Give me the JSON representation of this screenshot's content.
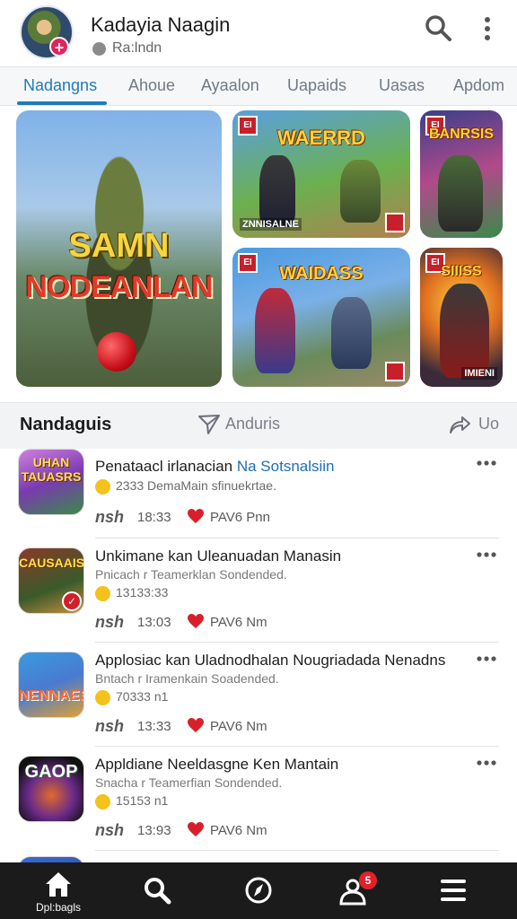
{
  "header": {
    "profile_name": "Kadayia Naagin",
    "profile_sub": "Ra:lndn"
  },
  "tabs": [
    {
      "label": "Nadangns",
      "active": true
    },
    {
      "label": "Ahoue",
      "active": false
    },
    {
      "label": "Ayaalon",
      "active": false
    },
    {
      "label": "Uapaids",
      "active": false
    },
    {
      "label": "Uasas",
      "active": false
    },
    {
      "label": "Apdom",
      "active": false
    }
  ],
  "featured": {
    "big": {
      "title_line1": "SAMN",
      "title_line2": "NODEANLAN"
    },
    "cards": [
      {
        "badge": "EI",
        "title": "WAERRD",
        "caption": "ZNNISALNE"
      },
      {
        "badge": "EI",
        "title": "BANRSIS",
        "caption": ""
      },
      {
        "badge": "EI",
        "title": "WAIDASS",
        "caption": ""
      },
      {
        "badge": "EI",
        "title": "SIIISS",
        "caption": "IMIENI"
      }
    ]
  },
  "section": {
    "title": "Nandaguis",
    "middle_label": "Anduris",
    "right_label": "Uo"
  },
  "list": [
    {
      "icon_text": "UHAN TAUASRS",
      "title": "Penataacl irlanacian",
      "title_highlight": "Na Sotsnalsiin",
      "subtitle": "",
      "meta": "2333 DemaMain sfinuekrtae.",
      "ago": "nsh",
      "time": "18:33",
      "likes": "PAV6 Pnn"
    },
    {
      "icon_text": "CAUSAAIS",
      "title": "Unkimane kan Uleanuadan Manasin",
      "title_highlight": "",
      "subtitle": "Pnicach r Teamerklan Sondended.",
      "meta": "13133:33",
      "ago": "nsh",
      "time": "13:03",
      "likes": "PAV6 Nm"
    },
    {
      "icon_text": "NENNAES",
      "title": "Applosiac kan Uladnodhalan Nougriadada Nenadns",
      "title_highlight": "",
      "subtitle": "Bntach r Iramenkain Soadended.",
      "meta": "70333 n1",
      "ago": "nsh",
      "time": "13:33",
      "likes": "PAV6 Nm"
    },
    {
      "icon_text": "GAOP",
      "title": "Appldiane Neeldasgne Ken Mantain",
      "title_highlight": "",
      "subtitle": "Snacha r Teamerfian Sondended.",
      "meta": "15153 n1",
      "ago": "nsh",
      "time": "13:93",
      "likes": "PAV6 Nm"
    }
  ],
  "bottom_nav": [
    {
      "label": "Dpl:bagls",
      "icon": "home-icon"
    },
    {
      "label": "",
      "icon": "search-icon"
    },
    {
      "label": "",
      "icon": "compass-icon"
    },
    {
      "label": "",
      "icon": "people-icon",
      "badge": "5"
    },
    {
      "label": "",
      "icon": "menu-icon"
    }
  ],
  "colors": {
    "accent": "#1f7bb8",
    "heart": "#d8202a",
    "nav_bg": "#1b1b1b",
    "badge": "#e0245e"
  }
}
